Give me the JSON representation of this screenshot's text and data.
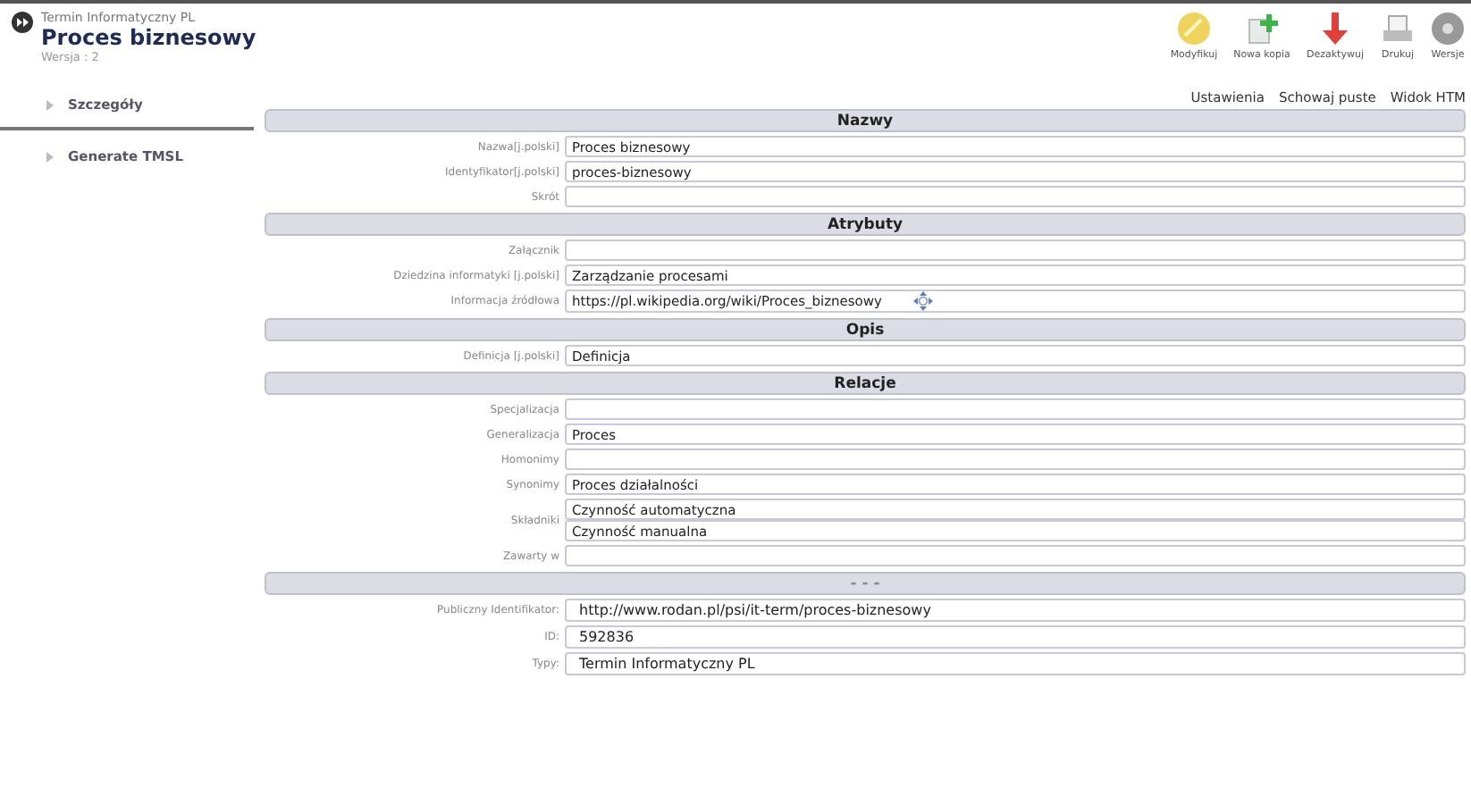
{
  "header": {
    "category": "Termin Informatyczny PL",
    "title": "Proces biznesowy",
    "version": "Wersja : 2"
  },
  "toolbar": [
    {
      "kind": "edit",
      "label": "Modyfikuj"
    },
    {
      "kind": "copy",
      "label": "Nowa kopia"
    },
    {
      "kind": "deactivate",
      "label": "Dezaktywuj"
    },
    {
      "kind": "print",
      "label": "Drukuj"
    },
    {
      "kind": "versions",
      "label": "Wersje"
    }
  ],
  "links": [
    "Ustawienia",
    "Schowaj puste",
    "Widok HTM"
  ],
  "sidebar": {
    "items": [
      {
        "label": "Szczegóły",
        "selected": true
      },
      {
        "label": "Generate TMSL",
        "selected": false
      }
    ]
  },
  "sections": [
    {
      "title": "Nazwy",
      "kind": "form",
      "fields": [
        {
          "label": "Nazwa[j.polski]",
          "values": [
            "Proces biznesowy"
          ]
        },
        {
          "label": "Identyfikator[j.polski]",
          "values": [
            "proces-biznesowy"
          ]
        },
        {
          "label": "Skrót"
        }
      ]
    },
    {
      "title": "Atrybuty",
      "kind": "form",
      "fields": [
        {
          "label": "Załącznik"
        },
        {
          "label": "Dziedzina informatyki [j.polski]",
          "values": [
            "Zarządzanie procesami"
          ]
        },
        {
          "label": "Informacja źródłowa",
          "values": [
            "https://pl.wikipedia.org/wiki/Proces_biznesowy"
          ],
          "movable": true
        }
      ]
    },
    {
      "title": "Opis",
      "kind": "form",
      "fields": [
        {
          "label": "Definicja [j.polski]",
          "values": [
            "Definicja"
          ]
        }
      ]
    },
    {
      "title": "Relacje",
      "kind": "form",
      "fields": [
        {
          "label": "Specjalizacja"
        },
        {
          "label": "Generalizacja",
          "values": [
            "Proces"
          ]
        },
        {
          "label": "Homonimy"
        },
        {
          "label": "Synonimy",
          "values": [
            "Proces działalności"
          ]
        },
        {
          "label": "Składniki",
          "values": [
            "Czynność automatyczna",
            "Czynność manualna"
          ]
        },
        {
          "label": "Zawarty w"
        }
      ]
    },
    {
      "title": "- - -",
      "kind": "meta",
      "fields": [
        {
          "label": "Publiczny Identifikator:",
          "values": [
            "http://www.rodan.pl/psi/it-term/proces-biznesowy"
          ]
        },
        {
          "label": "ID:",
          "values": [
            "592836"
          ]
        },
        {
          "label": "Typy:",
          "values": [
            "Termin Informatyczny PL"
          ]
        }
      ]
    }
  ]
}
